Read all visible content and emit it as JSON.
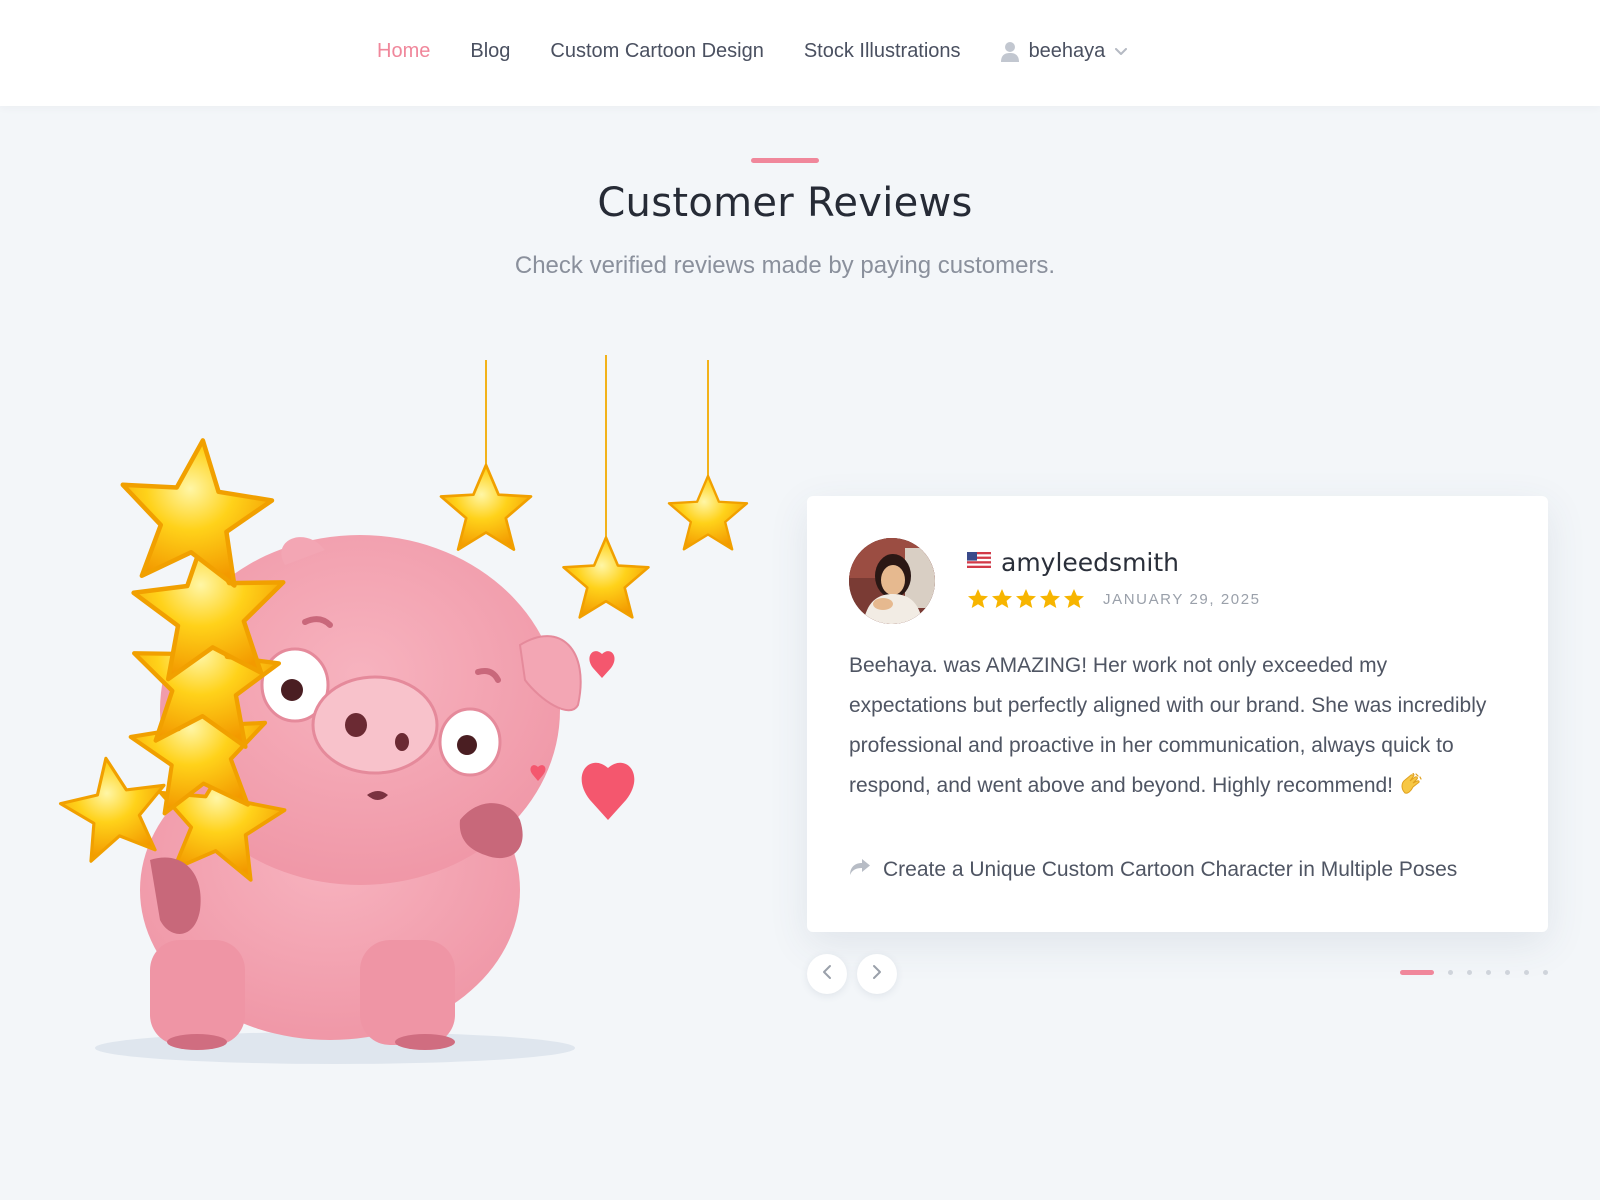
{
  "nav": {
    "items": [
      {
        "label": "Home",
        "active": true
      },
      {
        "label": "Blog",
        "active": false
      },
      {
        "label": "Custom Cartoon Design",
        "active": false
      },
      {
        "label": "Stock Illustrations",
        "active": false
      }
    ],
    "user": {
      "name": "beehaya",
      "icon": "user-icon",
      "caret_icon": "chevron-down-icon"
    }
  },
  "section": {
    "title": "Customer Reviews",
    "subtitle": "Check verified reviews made by paying customers."
  },
  "review": {
    "reviewer": "amyleedsmith",
    "country_flag_icon": "us-flag-icon",
    "rating": 5,
    "rating_max": 5,
    "date": "JANUARY 29, 2025",
    "text": "Beehaya. was AMAZING! Her work not only exceeded my expectations but perfectly aligned with our brand. She was incredibly professional and proactive in her communication, always quick to respond, and went above and beyond. Highly recommend!",
    "emoji": "clapping-hands-icon",
    "product_link": "Create a Unique Custom Cartoon Character in Multiple Poses"
  },
  "carousel": {
    "prev_icon": "chevron-left-icon",
    "next_icon": "chevron-right-icon",
    "slides_total": 7,
    "active_index": 0
  },
  "colors": {
    "accent": "#f0879b",
    "star": "#f7b500",
    "background": "#f3f6f9"
  }
}
